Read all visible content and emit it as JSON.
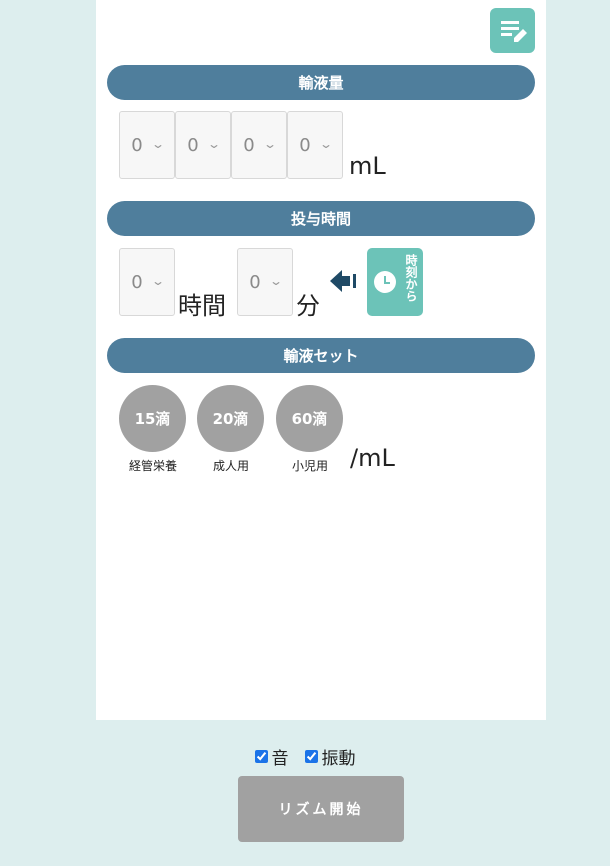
{
  "colors": {
    "accent_teal": "#6cc3b8",
    "section_blue": "#4f7e9c",
    "button_gray": "#a1a1a1",
    "page_bg": "#ddeeee"
  },
  "toolbar": {
    "memo_icon": "memo-edit-icon"
  },
  "volume": {
    "title": "輸液量",
    "digits": [
      "0",
      "0",
      "0",
      "0"
    ],
    "unit": "mL"
  },
  "duration": {
    "title": "投与時間",
    "hours": "0",
    "hours_unit": "時間",
    "minutes": "0",
    "minutes_unit": "分",
    "from_time_label": "時刻から"
  },
  "set": {
    "title": "輸液セット",
    "options": [
      {
        "value": "15滴",
        "label": "経管栄養"
      },
      {
        "value": "20滴",
        "label": "成人用"
      },
      {
        "value": "60滴",
        "label": "小児用"
      }
    ],
    "unit": "/mL"
  },
  "settings": {
    "sound_label": "音",
    "sound_checked": true,
    "vibration_label": "振動",
    "vibration_checked": true
  },
  "start_button": "リズム開始"
}
